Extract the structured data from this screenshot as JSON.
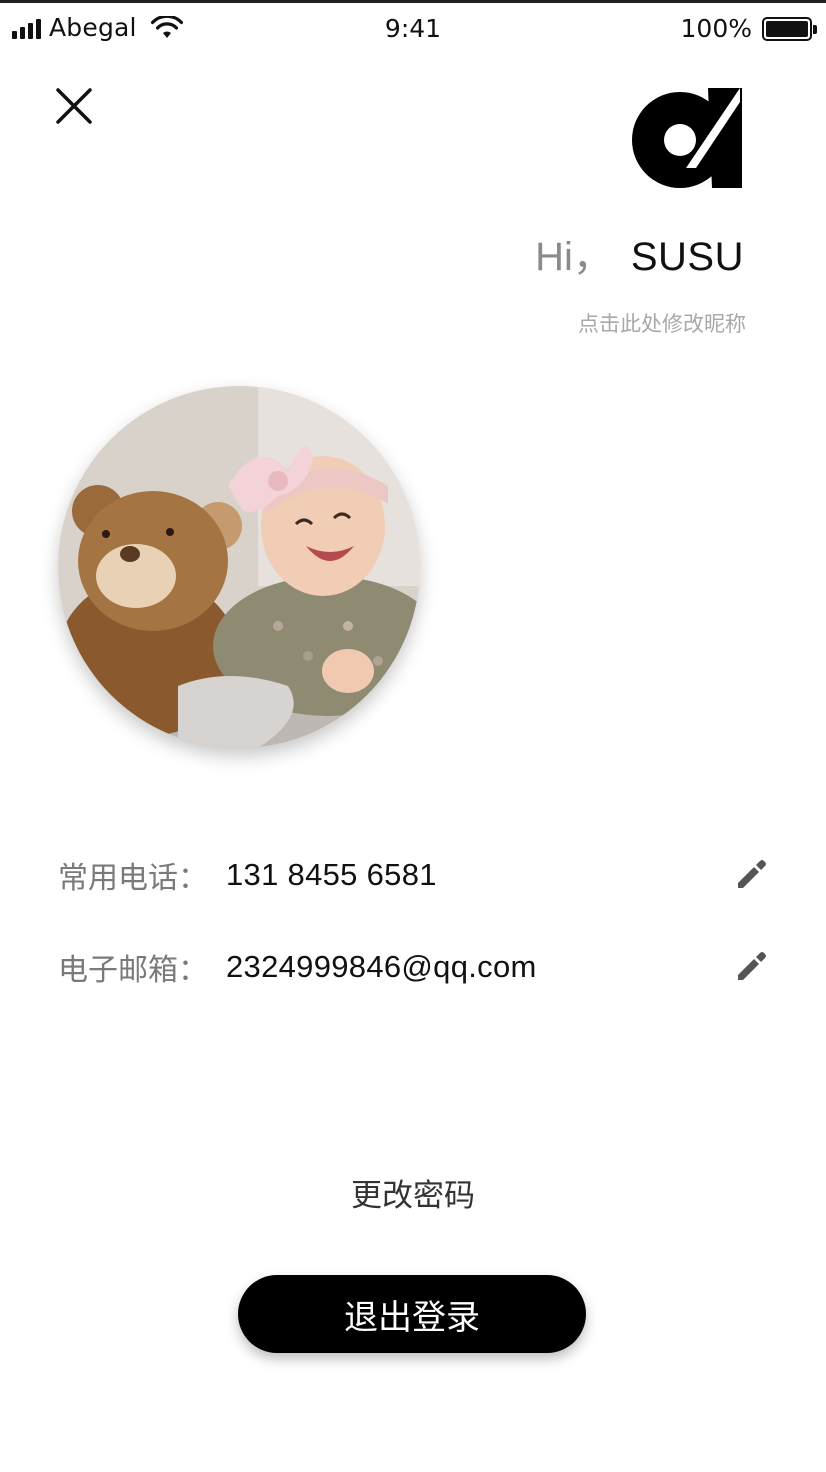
{
  "status_bar": {
    "carrier": "Abegal",
    "time": "9:41",
    "battery": "100%",
    "signal_icon": "signal-bars-icon",
    "wifi_icon": "wifi-icon",
    "battery_icon": "battery-icon"
  },
  "header": {
    "close_icon": "close-icon",
    "logo_icon": "brand-logo"
  },
  "greeting": {
    "hi": "Hi，",
    "name": "SUSU",
    "edit_nickname": "点击此处修改昵称"
  },
  "avatar": {
    "description": "avatar"
  },
  "contact": {
    "phone_label": "常用电话：",
    "phone_value": "131 8455 6581",
    "email_label": "电子邮箱：",
    "email_value": "2324999846@qq.com",
    "edit_icon": "pencil-icon"
  },
  "actions": {
    "change_password": "更改密码",
    "logout": "退出登录"
  },
  "colors": {
    "primary": "#000000",
    "label_gray": "#7a7a7a",
    "hint_gray": "#a8a8a8"
  }
}
